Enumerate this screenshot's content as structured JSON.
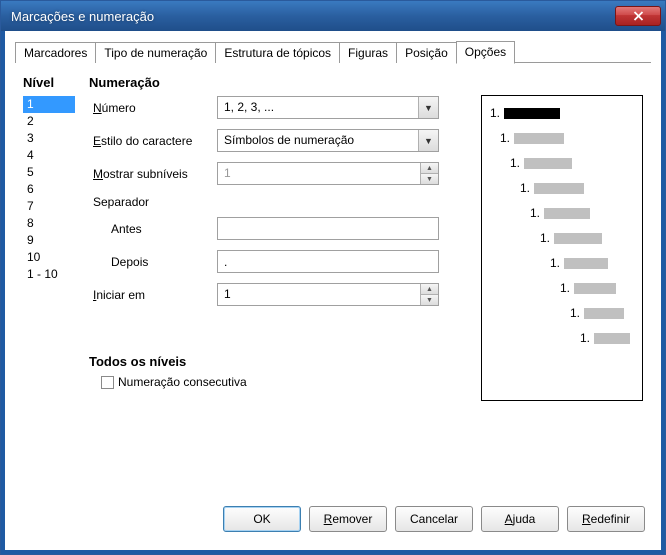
{
  "window": {
    "title": "Marcações e numeração"
  },
  "tabs": [
    {
      "label": "Marcadores"
    },
    {
      "label": "Tipo de numeração"
    },
    {
      "label": "Estrutura de tópicos"
    },
    {
      "label": "Figuras"
    },
    {
      "label": "Posição"
    },
    {
      "label": "Opções",
      "active": true
    }
  ],
  "level": {
    "heading": "Nível",
    "items": [
      "1",
      "2",
      "3",
      "4",
      "5",
      "6",
      "7",
      "8",
      "9",
      "10",
      "1 - 10"
    ],
    "selected": "1"
  },
  "numbering": {
    "heading": "Numeração",
    "number_label": "Número",
    "number_value": "1, 2, 3, ...",
    "charstyle_label": "Estilo do caractere",
    "charstyle_value": "Símbolos de numeração",
    "sublevels_label": "Mostrar subníveis",
    "sublevels_value": "1",
    "separator_label": "Separador",
    "before_label": "Antes",
    "before_value": "",
    "after_label": "Depois",
    "after_value": ".",
    "start_label": "Iniciar em",
    "start_value": "1"
  },
  "all_levels": {
    "heading": "Todos os níveis",
    "consecutive_label": "Numeração consecutiva",
    "consecutive_checked": false
  },
  "preview": {
    "label_prefix": "1."
  },
  "buttons": {
    "ok": "OK",
    "remove": "Remover",
    "cancel": "Cancelar",
    "help": "Ajuda",
    "reset": "Redefinir"
  }
}
